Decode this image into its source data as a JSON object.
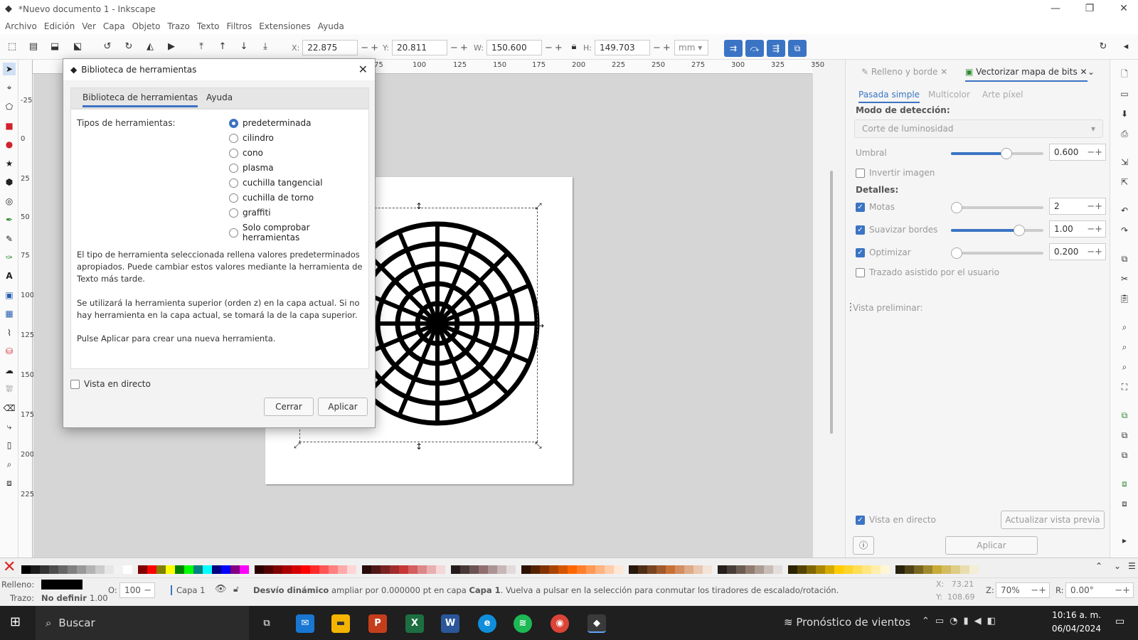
{
  "window": {
    "title": "*Nuevo documento 1 - Inkscape"
  },
  "menu": [
    "Archivo",
    "Edición",
    "Ver",
    "Capa",
    "Objeto",
    "Trazo",
    "Texto",
    "Filtros",
    "Extensiones",
    "Ayuda"
  ],
  "toolbar": {
    "x_label": "X:",
    "x": "22.875",
    "y_label": "Y:",
    "y": "20.811",
    "w_label": "W:",
    "w": "150.600",
    "h_label": "H:",
    "h": "149.703",
    "unit": "mm"
  },
  "ruler_h": [
    "75",
    "100",
    "125",
    "150",
    "175",
    "200",
    "225",
    "250",
    "275",
    "300",
    "325",
    "350"
  ],
  "ruler_v": [
    "-25",
    "0",
    "25",
    "50",
    "75",
    "100",
    "125",
    "150",
    "175",
    "200",
    "225"
  ],
  "dialog": {
    "title": "Biblioteca de herramientas",
    "tabs": [
      "Biblioteca de herramientas",
      "Ayuda"
    ],
    "types_label": "Tipos de herramientas:",
    "options": [
      "predeterminada",
      "cilindro",
      "cono",
      "plasma",
      "cuchilla tangencial",
      "cuchilla de torno",
      "graffiti",
      "Solo comprobar herramientas"
    ],
    "para1": "El tipo de herramienta seleccionada rellena valores predeterminados apropiados. Puede cambiar estos valores mediante la herramienta de Texto más tarde.",
    "para2": "Se utilizará la herramienta superior (orden z) en la capa actual. Si no hay herramienta en la capa actual, se tomará la de la capa superior.",
    "para3": "Pulse Aplicar para crear una nueva herramienta.",
    "live_preview": "Vista en directo",
    "close_btn": "Cerrar",
    "apply_btn": "Aplicar"
  },
  "panel": {
    "tab1": "Relleno y borde",
    "tab2": "Vectorizar mapa de bits",
    "subtabs": [
      "Pasada simple",
      "Multicolor",
      "Arte píxel"
    ],
    "mode_label": "Modo de detección:",
    "mode_value": "Corte de luminosidad",
    "threshold_label": "Umbral",
    "threshold": "0.600",
    "threshold_level": 0.6,
    "invert": "Invertir imagen",
    "details": "Detalles:",
    "specks": "Motas",
    "specks_val": "2",
    "smooth": "Suavizar bordes",
    "smooth_val": "1.00",
    "optimize": "Optimizar",
    "optimize_val": "0.200",
    "assisted": "Trazado asistido por el usuario",
    "preview_label": "Vista preliminar:",
    "live": "Vista en directo",
    "update": "Actualizar vista previa",
    "apply": "Aplicar"
  },
  "status": {
    "fill_label": "Relleno:",
    "stroke_label": "Trazo:",
    "stroke_value": "No definir",
    "stroke_width": "1.00",
    "opacity_label": "O:",
    "opacity": "100",
    "layer": "Capa 1",
    "msg_bold": "Desvío dinámico",
    "msg": " ampliar por 0.000000 pt en capa ",
    "msg_layer": "Capa 1",
    "msg_tail": ". Vuelva a pulsar en la selección para conmutar los tiradores de escalado/rotación.",
    "cx": "X:   73.21",
    "cy": "Y:  108.69",
    "zoom_label": "Z:",
    "zoom": "70%",
    "rot_label": "R:",
    "rot": "0.00°"
  },
  "taskbar": {
    "search": "Buscar",
    "weather": "Pronóstico de vientos",
    "time": "10:16 a. m.",
    "date": "06/04/2024"
  },
  "colors": {
    "accent": "#3b74c4"
  }
}
